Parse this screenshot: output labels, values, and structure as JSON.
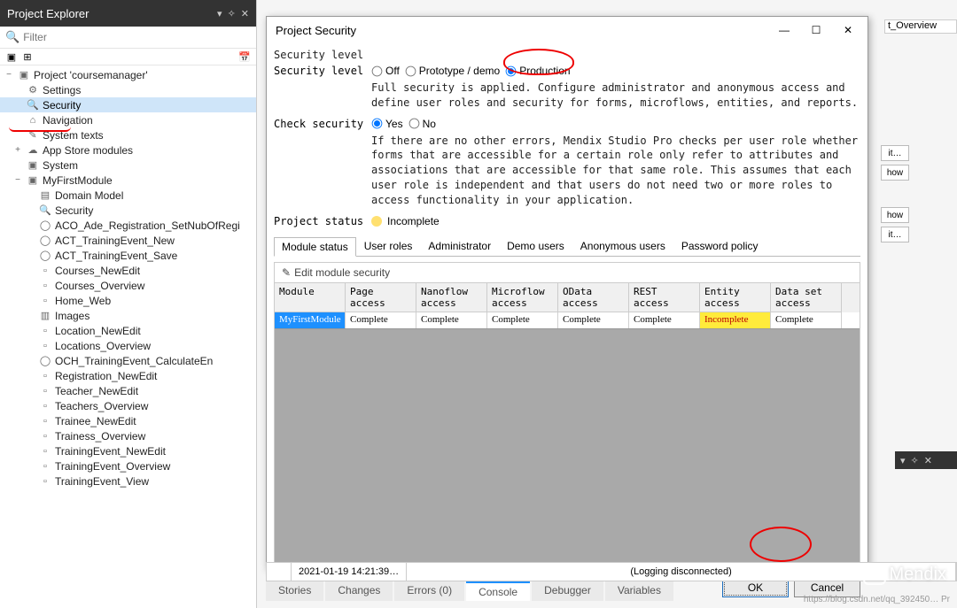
{
  "explorer": {
    "title": "Project Explorer",
    "filter_placeholder": "Filter",
    "tree": {
      "project": "Project 'coursemanager'",
      "settings": "Settings",
      "security": "Security",
      "navigation": "Navigation",
      "system_texts": "System texts",
      "app_store": "App Store modules",
      "system": "System",
      "module": "MyFirstModule",
      "domain_model": "Domain Model",
      "security2": "Security",
      "items": [
        "ACO_Ade_Registration_SetNubOfRegi",
        "ACT_TrainingEvent_New",
        "ACT_TrainingEvent_Save",
        "Courses_NewEdit",
        "Courses_Overview",
        "Home_Web",
        "Images",
        "Location_NewEdit",
        "Locations_Overview",
        "OCH_TrainingEvent_CalculateEn",
        "Registration_NewEdit",
        "Teacher_NewEdit",
        "Teachers_Overview",
        "Trainee_NewEdit",
        "Trainess_Overview",
        "TrainingEvent_NewEdit",
        "TrainingEvent_Overview",
        "TrainingEvent_View"
      ]
    }
  },
  "right_tab": "t_Overview",
  "right_buttons": {
    "a": "it…",
    "b": "how",
    "c": "how",
    "d": "it…"
  },
  "dialog": {
    "title": "Project Security",
    "section1": "Security level",
    "sec_level_label": "Security level",
    "radios": {
      "off": "Off",
      "proto": "Prototype / demo",
      "prod": "Production"
    },
    "sec_desc": "Full security is applied. Configure administrator and anonymous access and define user roles and security for forms, microflows, entities, and reports.",
    "check_label": "Check security",
    "check_radios": {
      "yes": "Yes",
      "no": "No"
    },
    "check_desc": "If there are no other errors, Mendix Studio Pro checks per user role whether forms that are accessible for a certain role only refer to attributes and associations that are accessible for that same role. This assumes that each user role is independent and that users do not need two or more roles to access functionality in your application.",
    "status_label": "Project status",
    "status_value": "Incomplete",
    "tabs": [
      "Module status",
      "User roles",
      "Administrator",
      "Demo users",
      "Anonymous users",
      "Password policy"
    ],
    "edit_label": "Edit module security",
    "columns": [
      "Module",
      "Page access",
      "Nanoflow access",
      "Microflow access",
      "OData access",
      "REST access",
      "Entity access",
      "Data set access"
    ],
    "row": {
      "module": "MyFirstModule",
      "page": "Complete",
      "nano": "Complete",
      "micro": "Complete",
      "odata": "Complete",
      "rest": "Complete",
      "entity": "Incomplete",
      "dataset": "Complete"
    },
    "ok": "OK",
    "cancel": "Cancel"
  },
  "console": {
    "timestamp": "2021-01-19 14:21:39…",
    "msg": "(Logging disconnected)"
  },
  "bottom_tabs": [
    "Stories",
    "Changes",
    "Errors (0)",
    "Console",
    "Debugger",
    "Variables"
  ],
  "brand": "Mendix",
  "foot": "https://blog.csdn.net/qq_392450…  Pr"
}
